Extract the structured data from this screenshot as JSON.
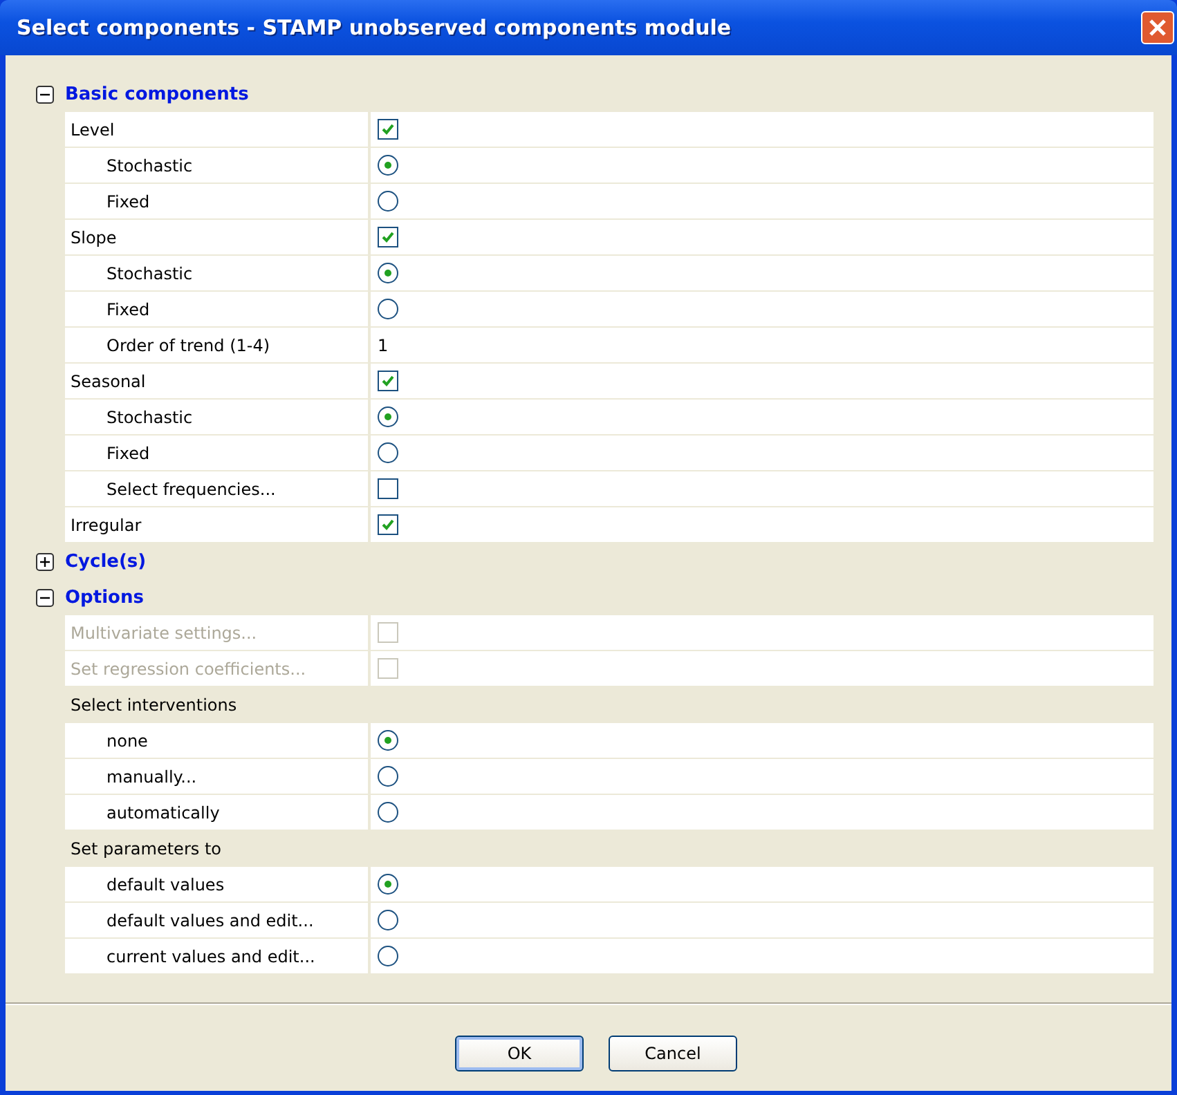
{
  "window": {
    "title": "Select components - STAMP unobserved components module"
  },
  "sections": [
    {
      "title": "Basic components",
      "expanded": true,
      "rows": [
        {
          "label": "Level",
          "kind": "checkbox",
          "checked": true,
          "disabled": false,
          "children": [
            {
              "label": "Stochastic",
              "kind": "radio",
              "selected": true
            },
            {
              "label": "Fixed",
              "kind": "radio",
              "selected": false
            }
          ]
        },
        {
          "label": "Slope",
          "kind": "checkbox",
          "checked": true,
          "disabled": false,
          "children": [
            {
              "label": "Stochastic",
              "kind": "radio",
              "selected": true
            },
            {
              "label": "Fixed",
              "kind": "radio",
              "selected": false
            },
            {
              "label": "Order of trend (1-4)",
              "kind": "text",
              "value": "1"
            }
          ]
        },
        {
          "label": "Seasonal",
          "kind": "checkbox",
          "checked": true,
          "disabled": false,
          "children": [
            {
              "label": "Stochastic",
              "kind": "radio",
              "selected": true
            },
            {
              "label": "Fixed",
              "kind": "radio",
              "selected": false
            },
            {
              "label": "Select frequencies...",
              "kind": "checkbox",
              "checked": false,
              "disabled": false
            }
          ]
        },
        {
          "label": "Irregular",
          "kind": "checkbox",
          "checked": true,
          "disabled": false
        }
      ]
    },
    {
      "title": "Cycle(s)",
      "expanded": false
    },
    {
      "title": "Options",
      "expanded": true,
      "rows": [
        {
          "label": "Multivariate settings...",
          "kind": "checkbox",
          "checked": false,
          "disabled": true
        },
        {
          "label": "Set regression coefficients...",
          "kind": "checkbox",
          "checked": false,
          "disabled": true
        },
        {
          "label": "Select interventions",
          "kind": "heading",
          "children": [
            {
              "label": "none",
              "kind": "radio",
              "selected": true
            },
            {
              "label": "manually...",
              "kind": "radio",
              "selected": false
            },
            {
              "label": "automatically",
              "kind": "radio",
              "selected": false
            }
          ]
        },
        {
          "label": "Set parameters to",
          "kind": "heading",
          "children": [
            {
              "label": "default values",
              "kind": "radio",
              "selected": true
            },
            {
              "label": "default values and edit...",
              "kind": "radio",
              "selected": false
            },
            {
              "label": "current values and edit...",
              "kind": "radio",
              "selected": false
            }
          ]
        }
      ]
    }
  ],
  "buttons": [
    "OK",
    "Cancel"
  ]
}
